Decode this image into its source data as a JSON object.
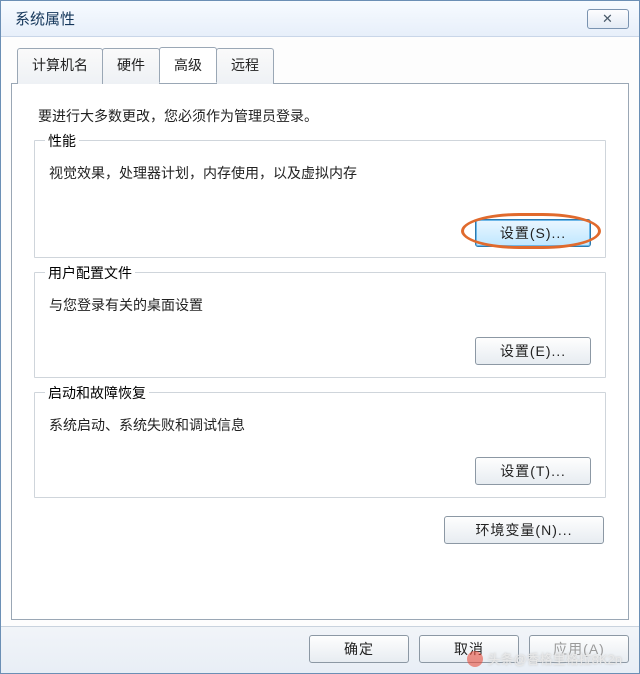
{
  "window": {
    "title": "系统属性",
    "close_glyph": "✕"
  },
  "tabs": {
    "computer_name": "计算机名",
    "hardware": "硬件",
    "advanced": "高级",
    "remote": "远程"
  },
  "advanced": {
    "intro": "要进行大多数更改，您必须作为管理员登录。",
    "perf": {
      "legend": "性能",
      "desc": "视觉效果，处理器计划，内存使用，以及虚拟内存",
      "button": "设置(S)..."
    },
    "profiles": {
      "legend": "用户配置文件",
      "desc": "与您登录有关的桌面设置",
      "button": "设置(E)..."
    },
    "startup": {
      "legend": "启动和故障恢复",
      "desc": "系统启动、系统失败和调试信息",
      "button": "设置(T)..."
    },
    "env_button": "环境变量(N)..."
  },
  "dialog": {
    "ok": "确定",
    "cancel": "取消",
    "apply": "应用(A)"
  },
  "watermark": "头条@香格里格拉8K2n"
}
